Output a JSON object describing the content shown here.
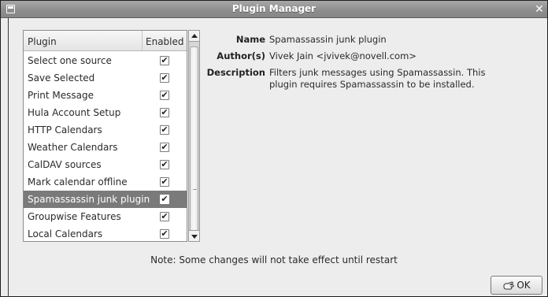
{
  "window": {
    "title": "Plugin Manager",
    "close_glyph": "✕"
  },
  "plugin_list": {
    "columns": {
      "plugin": "Plugin",
      "enabled": "Enabled"
    },
    "rows": [
      {
        "label": "Select one source",
        "enabled": true
      },
      {
        "label": "Save Selected",
        "enabled": true
      },
      {
        "label": "Print Message",
        "enabled": true
      },
      {
        "label": "Hula Account Setup",
        "enabled": true
      },
      {
        "label": "HTTP Calendars",
        "enabled": true
      },
      {
        "label": "Weather Calendars",
        "enabled": true
      },
      {
        "label": "CalDAV sources",
        "enabled": true
      },
      {
        "label": "Mark calendar offline",
        "enabled": true
      },
      {
        "label": "Spamassassin junk plugin",
        "enabled": true,
        "selected": true
      },
      {
        "label": "Groupwise Features",
        "enabled": true
      },
      {
        "label": "Local Calendars",
        "enabled": true
      }
    ],
    "check_glyph": "✔"
  },
  "details": {
    "name_label": "Name",
    "name_value": "Spamassassin junk plugin",
    "author_label": "Author(s)",
    "author_value": "Vivek Jain <jvivek@novell.com>",
    "description_label": "Description",
    "description_value": "Filters junk messages using Spamassassin. This plugin requires Spamassassin to be installed."
  },
  "note": "Note: Some changes will not take effect until restart",
  "ok_button": {
    "label": "OK"
  }
}
